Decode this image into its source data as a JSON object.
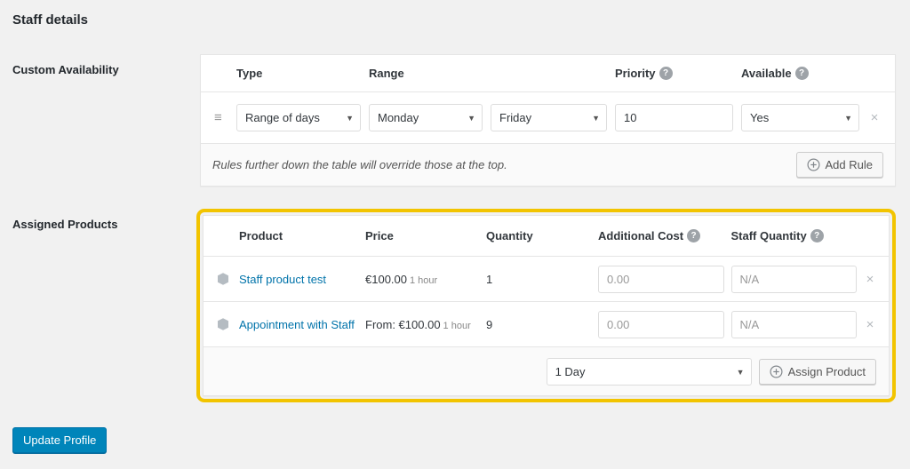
{
  "page": {
    "title": "Staff details",
    "background": "#f1f1f1"
  },
  "colors": {
    "link": "#0073aa",
    "primary_button": "#0085ba",
    "highlight_border": "#f2c400"
  },
  "custom_availability": {
    "section_label": "Custom Availability",
    "headers": {
      "type": "Type",
      "range": "Range",
      "priority": "Priority",
      "available": "Available"
    },
    "row": {
      "type_value": "Range of days",
      "range_from_value": "Monday",
      "range_to_value": "Friday",
      "priority_value": "10",
      "available_value": "Yes"
    },
    "footer_note": "Rules further down the table will override those at the top.",
    "add_rule_label": "Add Rule"
  },
  "assigned_products": {
    "section_label": "Assigned Products",
    "headers": {
      "product": "Product",
      "price": "Price",
      "quantity": "Quantity",
      "additional_cost": "Additional Cost",
      "staff_quantity": "Staff Quantity"
    },
    "rows": [
      {
        "product": "Staff product test",
        "price": "€100.00",
        "price_unit": "1 hour",
        "quantity": "1",
        "additional_cost_placeholder": "0.00",
        "staff_quantity_placeholder": "N/A"
      },
      {
        "product": "Appointment with Staff",
        "price": "From: €100.00",
        "price_unit": "1 hour",
        "quantity": "9",
        "additional_cost_placeholder": "0.00",
        "staff_quantity_placeholder": "N/A"
      }
    ],
    "footer": {
      "duration_value": "1 Day",
      "assign_product_label": "Assign Product"
    }
  },
  "icons": {
    "help": "?",
    "drag": "≡",
    "remove": "×",
    "caret": "▼"
  },
  "actions": {
    "update_profile_label": "Update Profile"
  }
}
